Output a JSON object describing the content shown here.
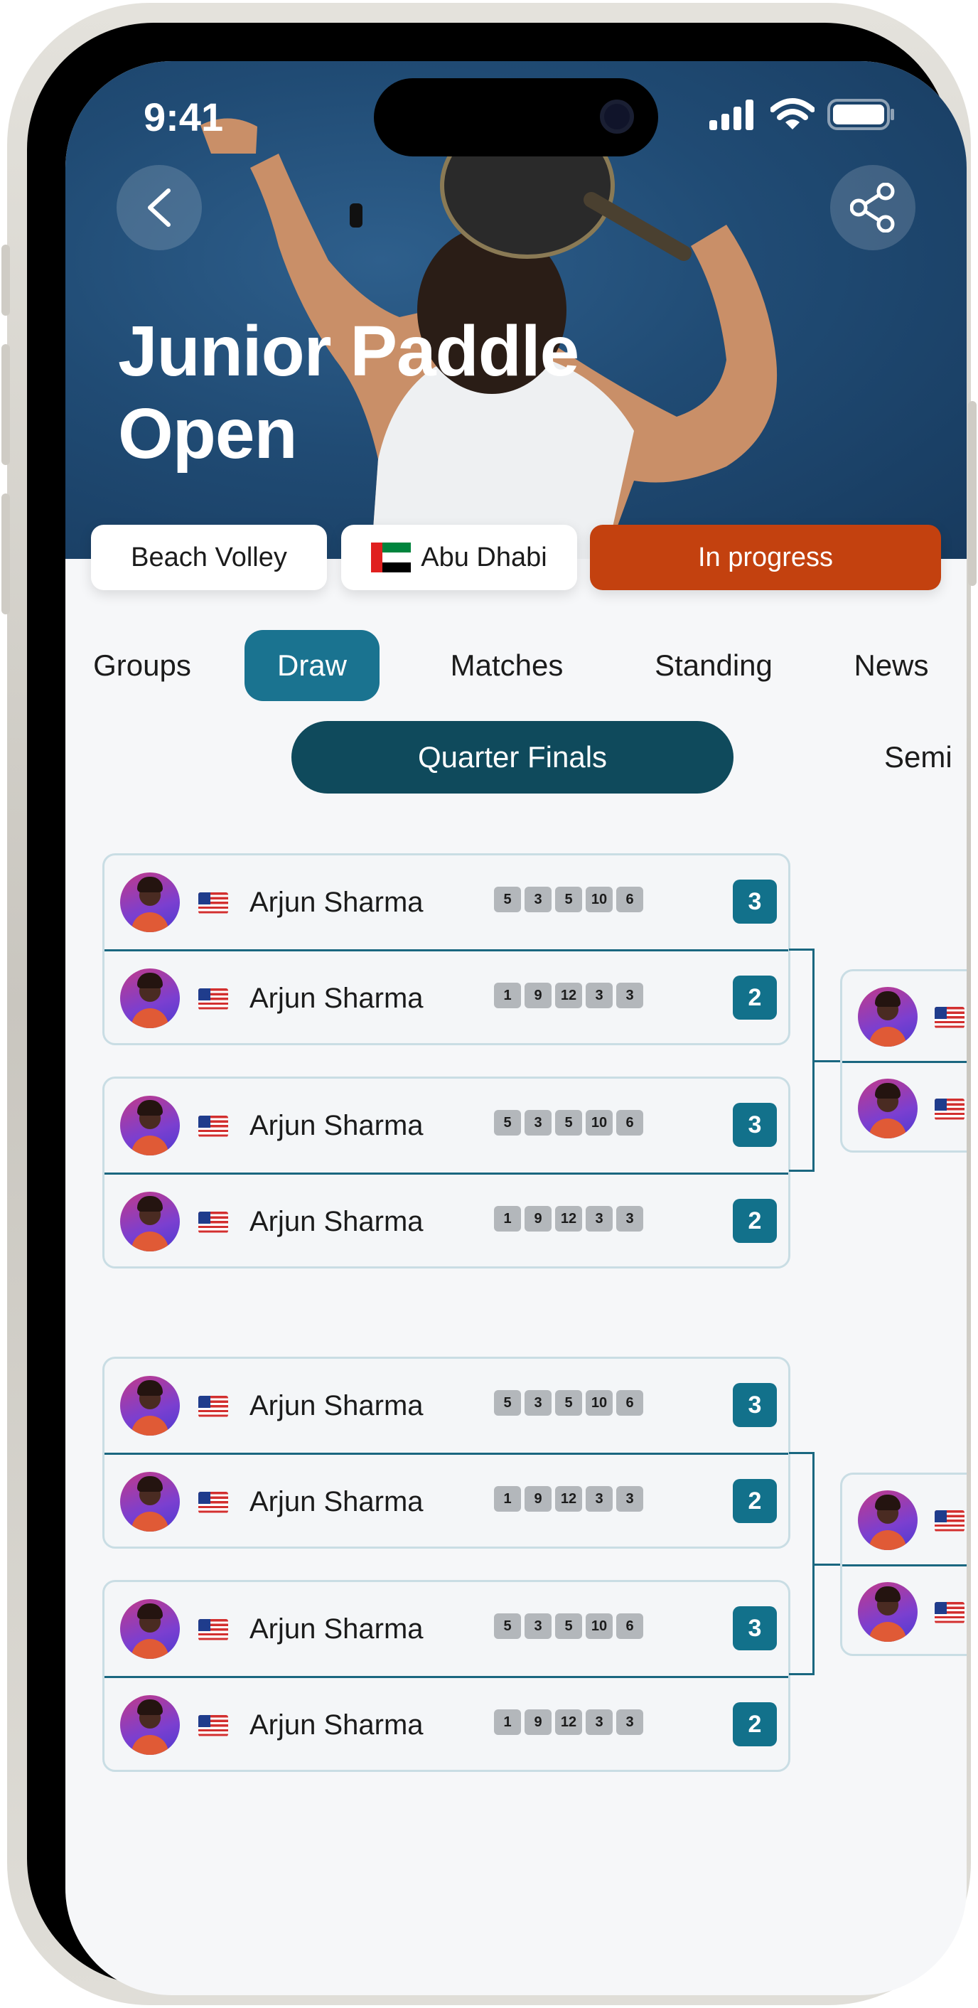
{
  "status_bar": {
    "time": "9:41"
  },
  "header": {
    "title": "Junior Paddle Open"
  },
  "chips": {
    "sport": "Beach Volley",
    "location": "Abu Dhabi",
    "status": "In progress"
  },
  "tabs": [
    "Groups",
    "Draw",
    "Matches",
    "Standing",
    "News"
  ],
  "active_tab": "Draw",
  "rounds": {
    "current": "Quarter Finals",
    "next": "Semi"
  },
  "matches": [
    {
      "p1": {
        "name": "Arjun Sharma",
        "sets": [
          "5",
          "3",
          "5",
          "10",
          "6"
        ],
        "total": "3"
      },
      "p2": {
        "name": "Arjun Sharma",
        "sets": [
          "1",
          "9",
          "12",
          "3",
          "3"
        ],
        "total": "2"
      }
    },
    {
      "p1": {
        "name": "Arjun Sharma",
        "sets": [
          "5",
          "3",
          "5",
          "10",
          "6"
        ],
        "total": "3"
      },
      "p2": {
        "name": "Arjun Sharma",
        "sets": [
          "1",
          "9",
          "12",
          "3",
          "3"
        ],
        "total": "2"
      }
    },
    {
      "p1": {
        "name": "Arjun Sharma",
        "sets": [
          "5",
          "3",
          "5",
          "10",
          "6"
        ],
        "total": "3"
      },
      "p2": {
        "name": "Arjun Sharma",
        "sets": [
          "1",
          "9",
          "12",
          "3",
          "3"
        ],
        "total": "2"
      }
    },
    {
      "p1": {
        "name": "Arjun Sharma",
        "sets": [
          "5",
          "3",
          "5",
          "10",
          "6"
        ],
        "total": "3"
      },
      "p2": {
        "name": "Arjun Sharma",
        "sets": [
          "1",
          "9",
          "12",
          "3",
          "3"
        ],
        "total": "2"
      }
    }
  ],
  "colors": {
    "accent": "#1a7390",
    "status": "#c3410f",
    "round_pill": "#0f4a5c",
    "score": "#12718b"
  },
  "icons": {
    "back": "chevron-left-icon",
    "share": "share-icon"
  }
}
